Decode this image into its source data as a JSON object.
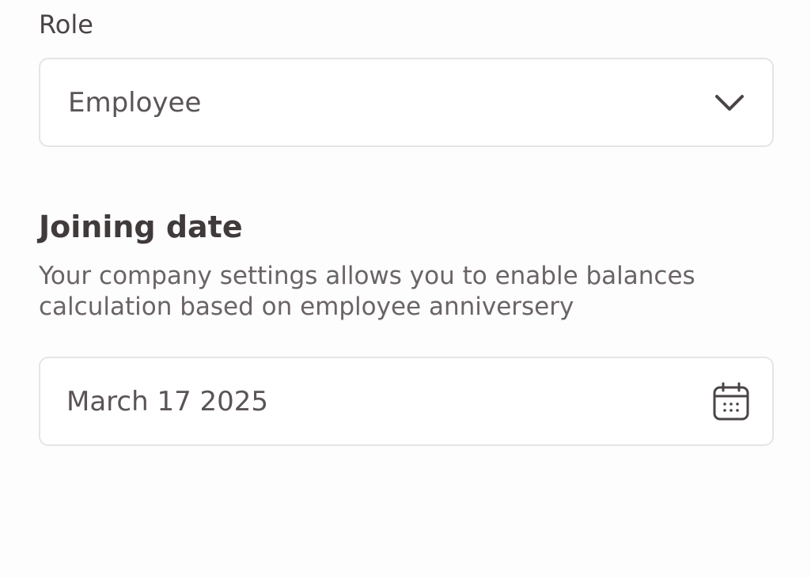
{
  "role": {
    "label": "Role",
    "selected": "Employee",
    "icon": "chevron-down-icon"
  },
  "joining_date": {
    "title": "Joining date",
    "description": "Your company settings allows you to enable balances\ncalculation based on employee anniversery",
    "value": "March 17 2025",
    "icon": "calendar-icon"
  }
}
